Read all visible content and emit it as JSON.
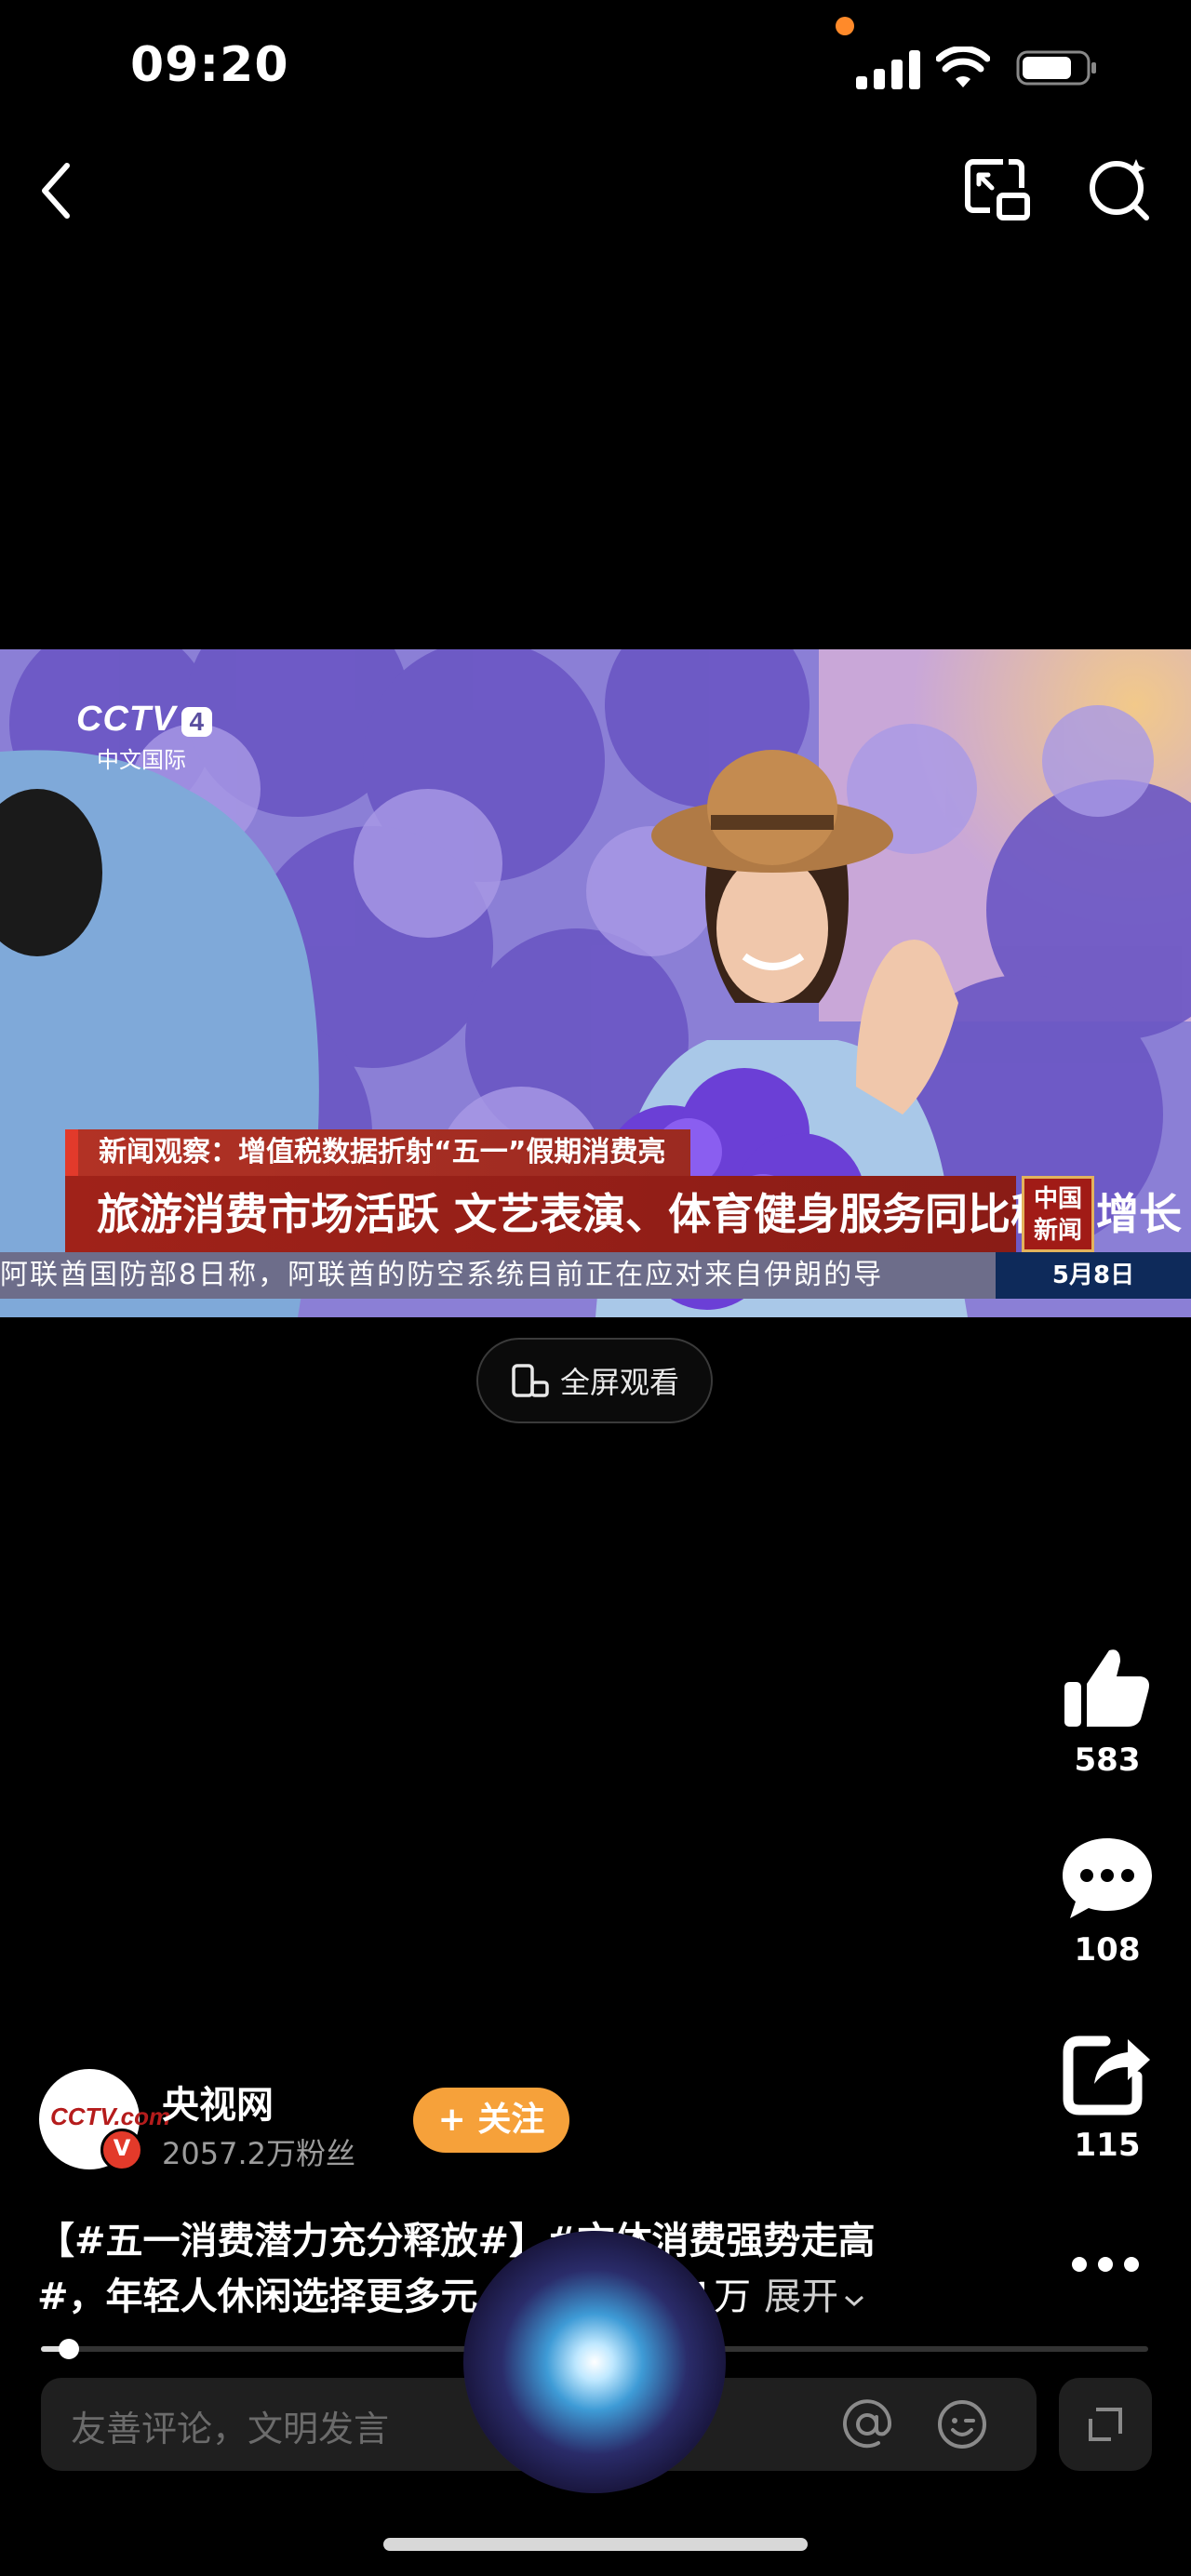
{
  "status_bar": {
    "time": "09:20"
  },
  "video": {
    "channel_logo": "CCTV",
    "channel_number": "4",
    "channel_sub": "中文国际",
    "news_subtitle": "新闻观察：增值税数据折射“五一”假期消费亮点",
    "news_headline": "旅游消费市场活跃 文艺表演、体育健身服务同比稳步增长",
    "badge_line1": "中国",
    "badge_line2": "新闻",
    "ticker_text": "阿联酋国防部8日称，阿联酋的防空系统目前正在应对来自伊朗的导",
    "ticker_date": "5月8日"
  },
  "fullscreen_label": "全屏观看",
  "actions": {
    "likes": "583",
    "comments": "108",
    "shares": "115"
  },
  "author": {
    "avatar_logo": "CCTV.com",
    "name": "央视网",
    "fans": "2057.2万粉丝",
    "follow_label": "+ 关注"
  },
  "description": {
    "line1": "【#五一消费潜力充分释放#】#文体消费强势走高",
    "line2": "#，年轻人休闲选择更多元",
    "line2_tail": "1.1万",
    "expand_label": "展开"
  },
  "progress": {
    "fraction": 0.025
  },
  "comment_input": {
    "placeholder": "友善评论，文明发言"
  },
  "icons": [
    "back-icon",
    "pip-icon",
    "search-icon",
    "like-icon",
    "comment-icon",
    "share-icon",
    "more-icon",
    "at-icon",
    "emoji-icon",
    "expand-icon",
    "siri-orb"
  ]
}
